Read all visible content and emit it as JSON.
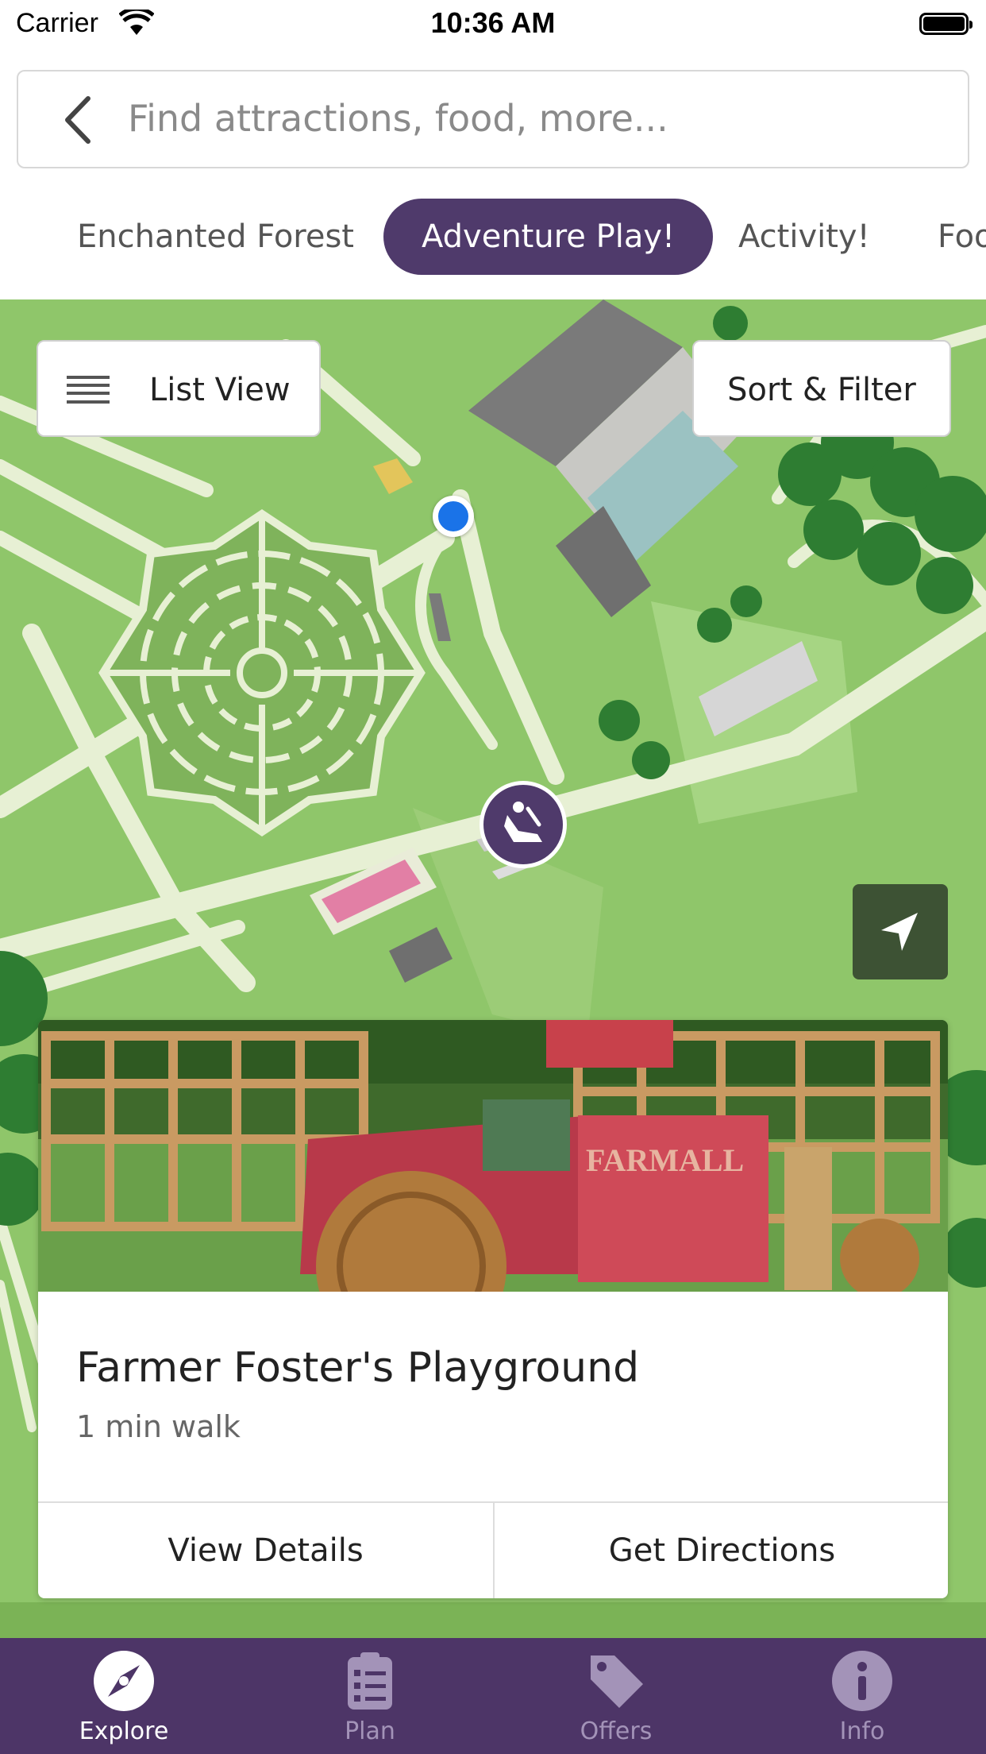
{
  "status_bar": {
    "carrier": "Carrier",
    "time": "10:36 AM"
  },
  "search": {
    "placeholder": "Find attractions, food, more..."
  },
  "categories": [
    {
      "label": "Enchanted Forest",
      "active": false
    },
    {
      "label": "Adventure Play!",
      "active": true
    },
    {
      "label": "Activity!",
      "active": false
    },
    {
      "label": "Foo",
      "active": false
    }
  ],
  "map": {
    "list_view_label": "List View",
    "sort_filter_label": "Sort & Filter"
  },
  "card": {
    "title": "Farmer Foster's Playground",
    "subtitle": "1 min walk",
    "actions": [
      "View Details",
      "Get Directions"
    ]
  },
  "tab_bar": [
    {
      "label": "Explore",
      "icon": "compass-icon",
      "active": true
    },
    {
      "label": "Plan",
      "icon": "clipboard-list-icon",
      "active": false
    },
    {
      "label": "Offers",
      "icon": "tag-icon",
      "active": false
    },
    {
      "label": "Info",
      "icon": "info-icon",
      "active": false
    }
  ],
  "colors": {
    "brand_purple": "#4d3567",
    "map_green": "#8fc66a",
    "location_blue": "#1a73e8"
  }
}
